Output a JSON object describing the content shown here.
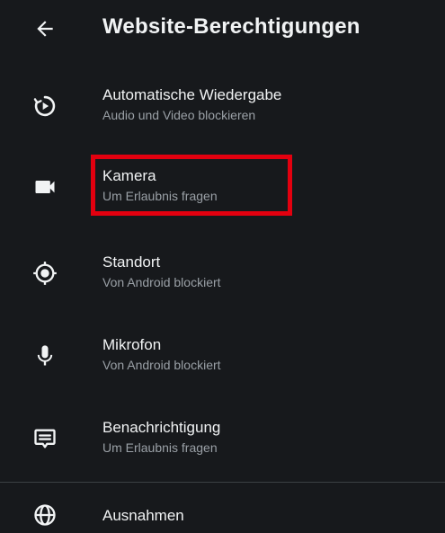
{
  "header": {
    "back_icon": "arrow-back-icon",
    "title": "Website-Berechtigungen"
  },
  "permissions": [
    {
      "label": "Automatische Wiedergabe",
      "status": "Audio und Video blockieren",
      "icon": "autoplay-icon"
    },
    {
      "label": "Kamera",
      "status": "Um Erlaubnis fragen",
      "icon": "camera-icon"
    },
    {
      "label": "Standort",
      "status": "Von Android blockiert",
      "icon": "location-icon"
    },
    {
      "label": "Mikrofon",
      "status": "Von Android blockiert",
      "icon": "microphone-icon"
    },
    {
      "label": "Benachrichtigung",
      "status": "Um Erlaubnis fragen",
      "icon": "notification-icon"
    }
  ],
  "exceptions": {
    "label": "Ausnahmen",
    "icon": "globe-icon"
  },
  "colors": {
    "background": "#17191c",
    "text_primary": "#f1f3f4",
    "text_secondary": "#9aa0a6",
    "highlight": "#e3000f"
  }
}
